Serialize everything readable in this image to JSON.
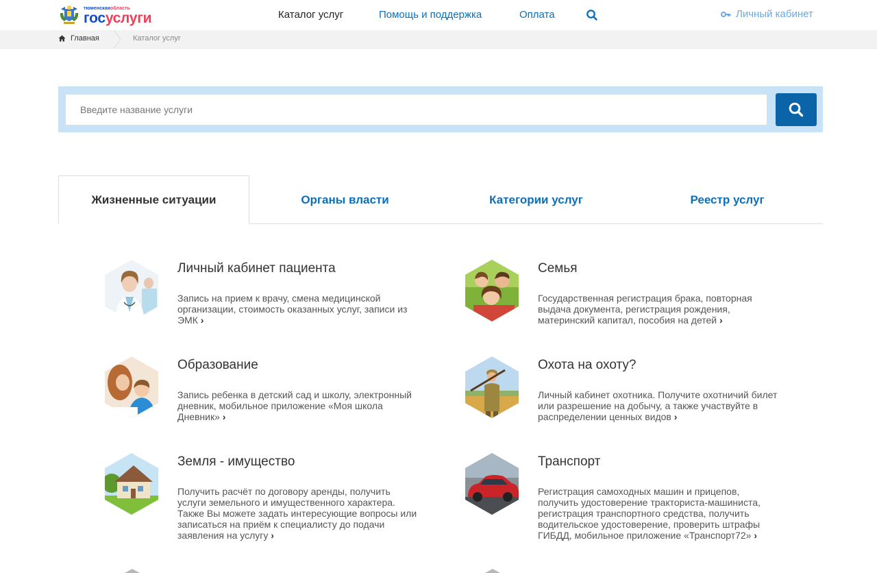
{
  "header": {
    "logo_sub_1": "тюменская",
    "logo_sub_2": "область",
    "logo_main_1": "гос",
    "logo_main_2": "услуги",
    "nav": {
      "catalog": "Каталог услуг",
      "help": "Помощь и поддержка",
      "payment": "Оплата",
      "cabinet": "Личный кабинет"
    }
  },
  "breadcrumb": {
    "home": "Главная",
    "current": "Каталог услуг"
  },
  "search": {
    "placeholder": "Введите название услуги",
    "value": ""
  },
  "tabs": [
    {
      "label": "Жизненные ситуации",
      "active": true
    },
    {
      "label": "Органы власти",
      "active": false
    },
    {
      "label": "Категории услуг",
      "active": false
    },
    {
      "label": "Реестр услуг",
      "active": false
    }
  ],
  "cards": [
    {
      "title": "Личный кабинет пациента",
      "desc": "Запись на прием к врачу, смена медицинской организации, стоимость оказанных услуг, записи из ЭМК",
      "image": "doctor-photo"
    },
    {
      "title": "Семья",
      "desc": "Государственная регистрация брака, повторная выдача документа, регистрация рождения, материнский капитал, пособия на детей",
      "image": "family-photo"
    },
    {
      "title": "Образование",
      "desc": "Запись ребенка в детский сад и школу, электронный дневник, мобильное приложение «Моя школа Дневник»",
      "image": "education-photo"
    },
    {
      "title": "Охота на охоту?",
      "desc": "Личный кабинет охотника. Получите охотничий билет или разрешение на добычу, а также участвуйте в распределении ценных видов",
      "image": "hunter-photo"
    },
    {
      "title": "Земля - имущество",
      "desc": "Получить расчёт по договору аренды, получить услуги земельного и имущественного характера. Также Вы можете задать интересующие вопросы или записаться на приём к специалисту до подачи заявления на услугу",
      "image": "house-photo"
    },
    {
      "title": "Транспорт",
      "desc": "Регистрация самоходных машин и прицепов, получить удостоверение тракториста-машиниста, регистрация транспортного средства, получить водительское удостоверение, проверить штрафы ГИБДД, мобильное приложение «Транспорт72»",
      "image": "car-photo"
    }
  ],
  "arrow_glyph": "›",
  "colors": {
    "brand_blue": "#0d4cd3",
    "brand_red": "#ee3f58",
    "link": "#0d6fb8",
    "search_bg": "#c8e2f7",
    "search_button": "#0c64a8"
  }
}
